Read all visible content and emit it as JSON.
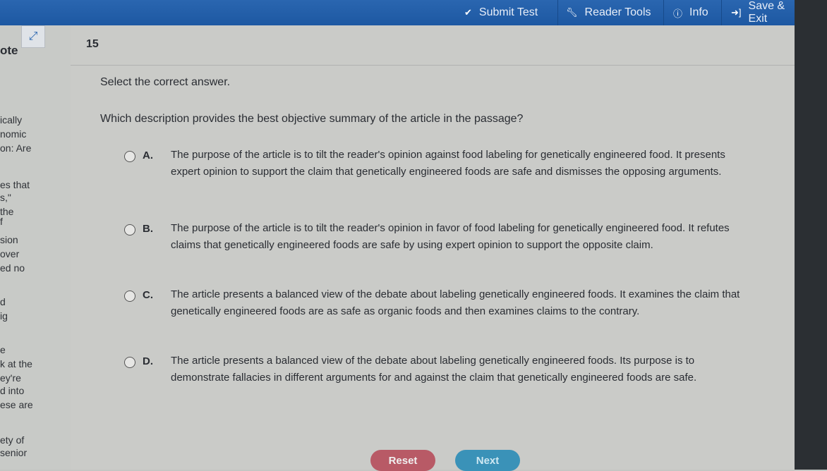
{
  "topbar": {
    "items": [
      {
        "label": "Submit Test",
        "icon": "check-circle-icon"
      },
      {
        "label": "Reader Tools",
        "icon": "wrench-icon"
      },
      {
        "label": "Info",
        "icon": "info-icon"
      },
      {
        "label": "Save & Exit",
        "icon": "sign-in-icon"
      }
    ]
  },
  "passage": {
    "title": "ote",
    "lines": [
      "ically",
      "nomic",
      "on: Are",
      "es that",
      "s,\"",
      "the",
      "f",
      "sion",
      " over",
      "ed no",
      "d",
      "ig",
      "e",
      "k at the",
      "ey're",
      "d into",
      "ese are",
      "ety of",
      "senior"
    ]
  },
  "question": {
    "number": "15",
    "instruction": "Select the correct answer.",
    "prompt": "Which description provides the best objective summary of the article in the passage?",
    "options": [
      {
        "letter": "A.",
        "text": "The purpose of the article is to tilt the reader's opinion against food labeling for genetically engineered food. It presents expert opinion to support the claim that genetically engineered foods are safe and dismisses the opposing arguments."
      },
      {
        "letter": "B.",
        "text": "The purpose of the article is to tilt the reader's opinion in favor of food labeling for genetically engineered food. It refutes claims that genetically engineered foods are safe by using expert opinion to support the opposite claim."
      },
      {
        "letter": "C.",
        "text": "The article presents a balanced view of the debate about labeling genetically engineered foods. It examines the claim that genetically engineered foods are as safe as organic foods and then examines claims to the contrary."
      },
      {
        "letter": "D.",
        "text": "The article presents a balanced view of the debate about labeling genetically engineered foods. Its purpose is to demonstrate fallacies in different arguments for and against the claim that genetically engineered foods are safe."
      }
    ]
  },
  "buttons": {
    "reset": "Reset",
    "next": "Next"
  }
}
